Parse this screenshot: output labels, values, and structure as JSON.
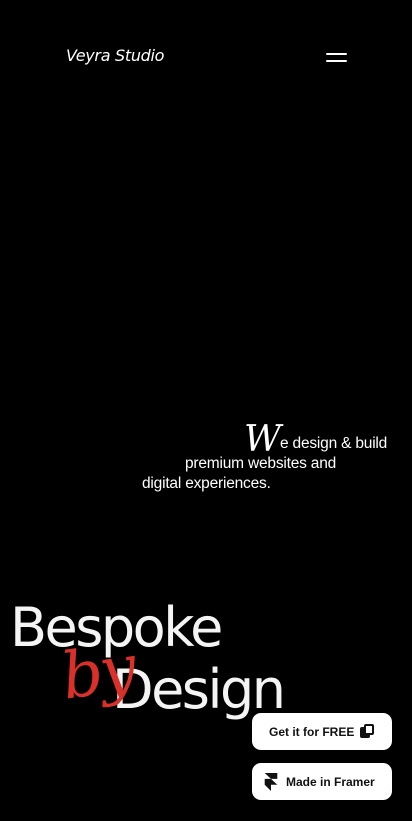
{
  "header": {
    "brand": "Veyra Studio",
    "menu_icon": "hamburger-menu-icon"
  },
  "hero": {
    "tagline_initial": "W",
    "tagline_line1": "e design & build",
    "tagline_line2": "premium websites and",
    "tagline_line3": "digital experiences.",
    "headline_word1": "Bespoke",
    "headline_script": "by",
    "headline_word2": "Design",
    "script_color": "#d9302a"
  },
  "buttons": {
    "get_free_label": "Get it for FREE",
    "get_free_icon": "copy-icon",
    "framer_label": "Made in Framer",
    "framer_icon": "framer-logo-icon"
  }
}
